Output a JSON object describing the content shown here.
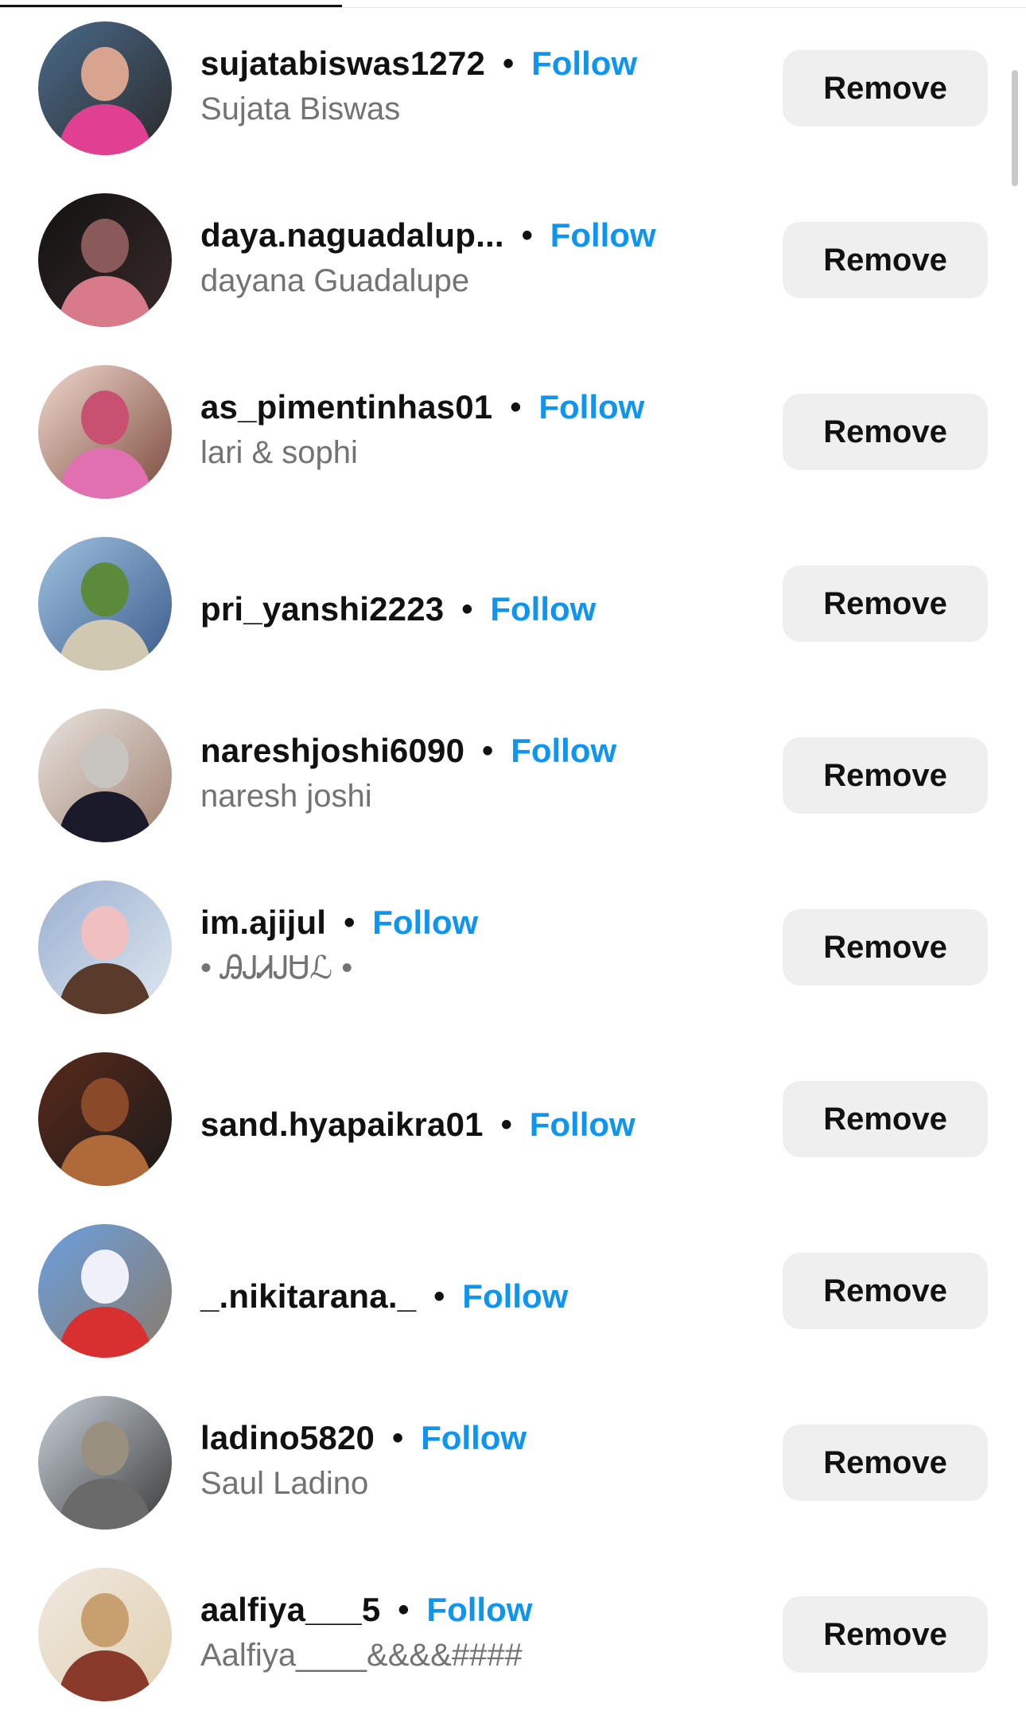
{
  "follow_label": "Follow",
  "remove_label": "Remove",
  "separator": "•",
  "colors": {
    "follow_blue": "#0d95f0",
    "remove_bg": "#efefef",
    "subtext_gray": "#737373"
  },
  "followers": [
    {
      "username": "sujatabiswas1272",
      "full_name": "Sujata Biswas",
      "avatar_palette": [
        "#4a6a8a",
        "#d9a48f",
        "#e13f8f",
        "#2a2a2a"
      ]
    },
    {
      "username": "daya.naguadalup...",
      "full_name": "dayana Guadalupe",
      "avatar_palette": [
        "#111111",
        "#8a5a5a",
        "#d97a8a",
        "#3a2a2a"
      ]
    },
    {
      "username": "as_pimentinhas01",
      "full_name": "lari & sophi",
      "avatar_palette": [
        "#f0d8d0",
        "#c85070",
        "#e070b0",
        "#7a4a3a"
      ]
    },
    {
      "username": "pri_yanshi2223",
      "full_name": "",
      "avatar_palette": [
        "#9fc2e0",
        "#5a8a3a",
        "#d0c8b0",
        "#3a5a8a"
      ]
    },
    {
      "username": "nareshjoshi6090",
      "full_name": "naresh joshi",
      "avatar_palette": [
        "#e8e4e0",
        "#c8c4c0",
        "#1a1a2a",
        "#a08070"
      ]
    },
    {
      "username": "im.ajijul",
      "full_name": "• ᎯᎫᏗᎫᏌℒ •",
      "avatar_palette": [
        "#9ab0d0",
        "#f0c0c0",
        "#5a3a2a",
        "#e0e8f0"
      ]
    },
    {
      "username": "sand.hyapaikra01",
      "full_name": "",
      "avatar_palette": [
        "#5a2a1a",
        "#8a4a2a",
        "#b06a3a",
        "#1a1a1a"
      ]
    },
    {
      "username": "_.nikitarana._",
      "full_name": "",
      "avatar_palette": [
        "#6aa0e0",
        "#f0f0f8",
        "#d83030",
        "#8a7a6a"
      ]
    },
    {
      "username": "ladino5820",
      "full_name": "Saul Ladino",
      "avatar_palette": [
        "#c8d0d8",
        "#9a9080",
        "#6a6a6a",
        "#3a3a3a"
      ]
    },
    {
      "username": "aalfiya___5",
      "full_name": "Aalfiya____&&&&####",
      "avatar_palette": [
        "#f0e8e0",
        "#c8a070",
        "#8a3a2a",
        "#e0d0b0"
      ]
    }
  ]
}
